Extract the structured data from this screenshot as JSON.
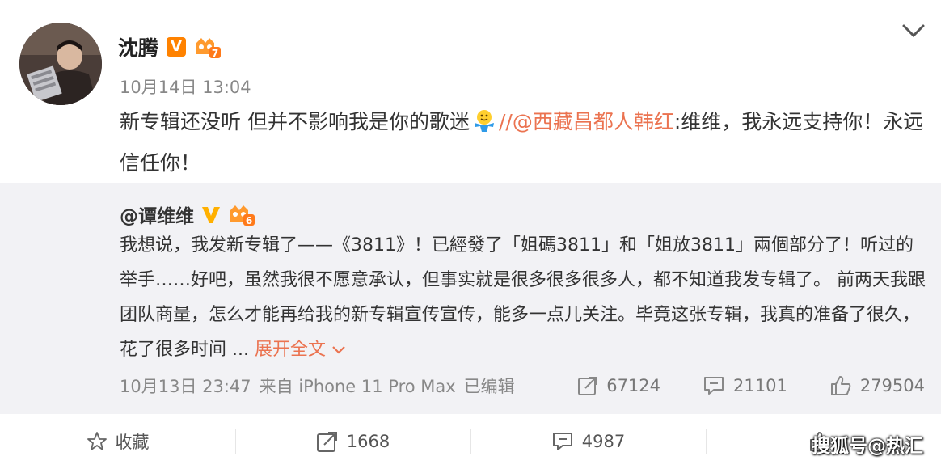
{
  "post": {
    "author": "沈腾",
    "verified_badge": "V",
    "vip_level": "7",
    "timestamp": "10月14日 13:04",
    "text_prefix": "新专辑还没听 但并不影响我是你的歌迷",
    "separator": "//",
    "mention": "@西藏昌都人韩红",
    "text_suffix": ":维维，我永远支持你！永远信任你！"
  },
  "repost": {
    "author": "@谭维维",
    "vip_level": "6",
    "text": "我想说，我发新专辑了——《3811》！已經發了「姐碼3811」和「姐放3811」兩個部分了！听过的举手……好吧，虽然我很不愿意承认，但事实就是很多很多很多人，都不知道我发专辑了。 前两天我跟团队商量，怎么才能再给我的新专辑宣传宣传，能多一点儿关注。毕竟这张专辑，我真的准备了很久，花了很多时间 ... ",
    "expand_label": "展开全文",
    "timestamp": "10月13日 23:47",
    "source": "来自 iPhone 11 Pro Max",
    "edited": "已编辑",
    "reposts": "67124",
    "comments": "21101",
    "likes": "279504"
  },
  "footer": {
    "favorite_label": "收藏",
    "repost_count": "1668",
    "comment_count": "4987",
    "like_count": "",
    "watermark": "搜狐号@热汇"
  },
  "colors": {
    "accent": "#eb7350",
    "verified_orange": "#ff8200",
    "repost_bg": "#f2f2f5"
  },
  "icons": [
    "chevron-down-icon",
    "verified-icon",
    "vip-crown-icon",
    "emoji-icon",
    "repost-icon",
    "comment-icon",
    "like-icon",
    "star-icon"
  ]
}
